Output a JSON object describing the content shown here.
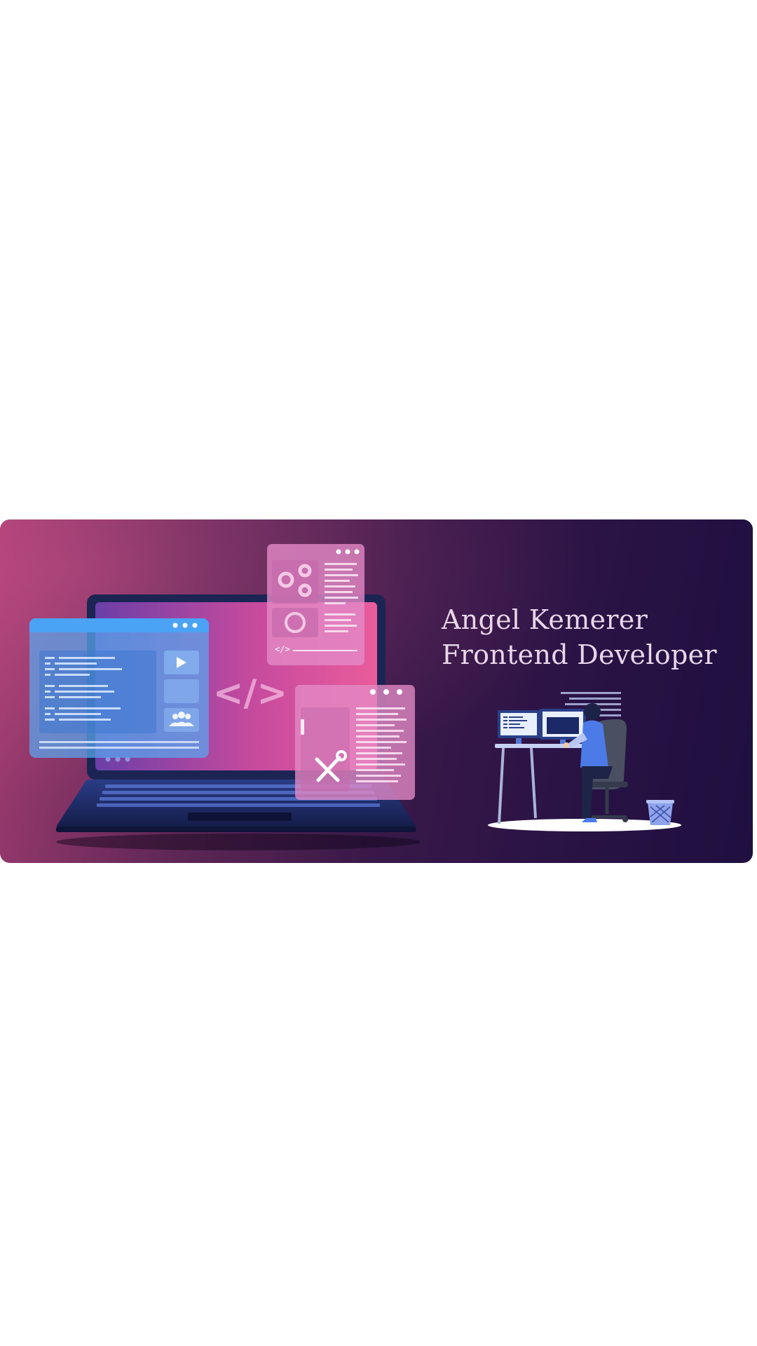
{
  "banner": {
    "name_line": "Angel Kemerer",
    "role_line": "Frontend Developer",
    "code_symbol": "</>",
    "mini_code_tag": "</>"
  },
  "colors": {
    "gradient_start": "#a43d72",
    "gradient_end": "#1f0f40",
    "headline": "#e9d6ea",
    "blue_window": "#4aa3f5",
    "pink_window": "#e48ac7"
  },
  "icons": [
    "laptop-illustration",
    "gear-icon",
    "loading-ring-icon",
    "play-icon",
    "users-icon",
    "tools-icon",
    "developer-at-desk-illustration",
    "wastebasket-icon"
  ]
}
